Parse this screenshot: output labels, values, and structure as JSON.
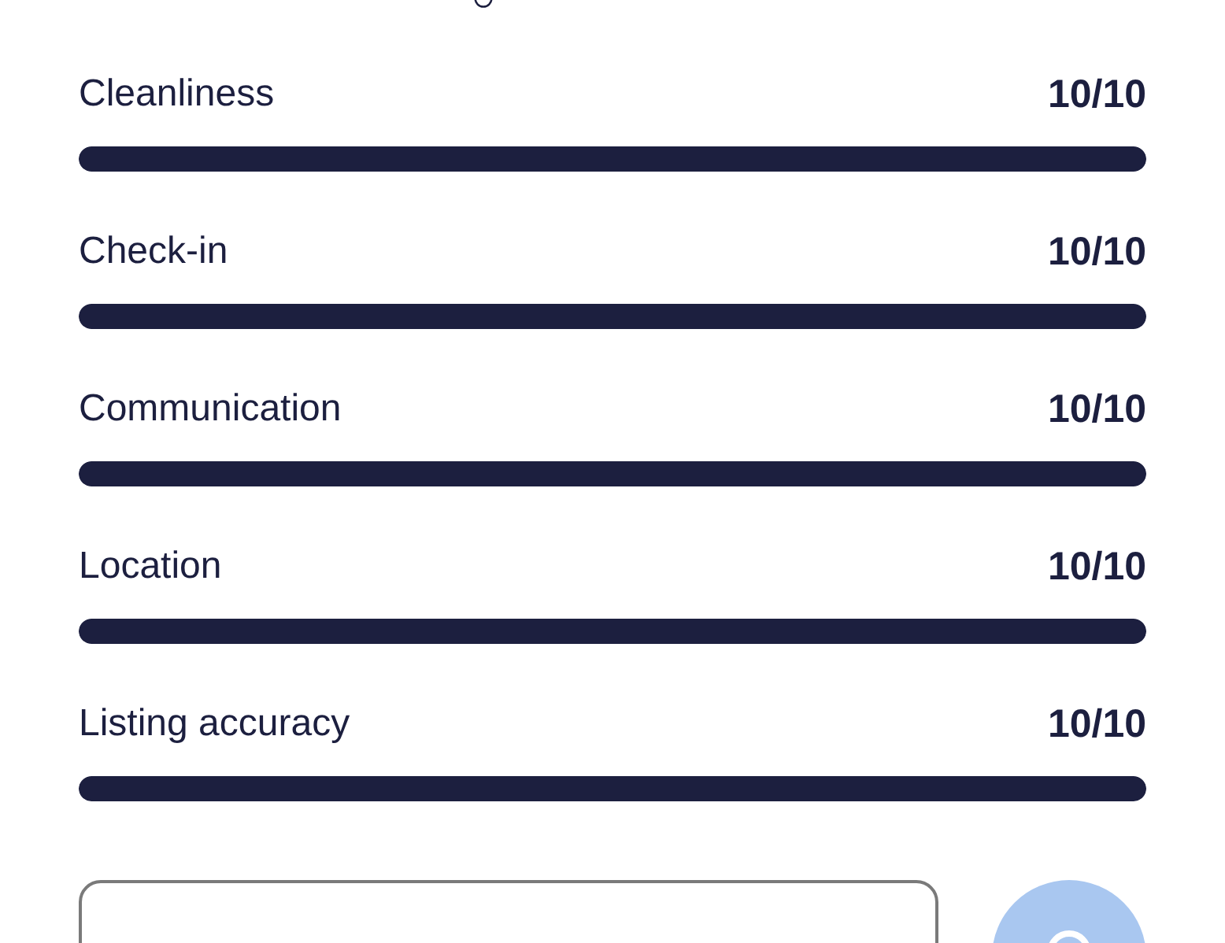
{
  "ratings": [
    {
      "name": "Cleanliness",
      "score": "10/10",
      "level": 1
    },
    {
      "name": "Check-in",
      "score": "10/10",
      "level": 1
    },
    {
      "name": "Communication",
      "score": "10/10",
      "level": 1
    },
    {
      "name": "Location",
      "score": "10/10",
      "level": 1
    },
    {
      "name": "Listing accuracy",
      "score": "10/10",
      "level": 1
    }
  ]
}
